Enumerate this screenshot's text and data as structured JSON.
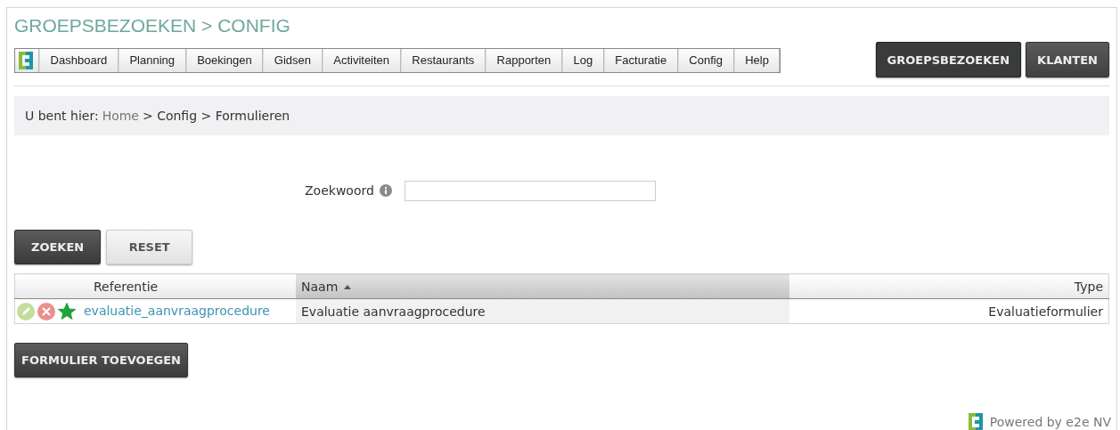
{
  "page_title": "GROEPSBEZOEKEN > CONFIG",
  "nav": [
    "Dashboard",
    "Planning",
    "Boekingen",
    "Gidsen",
    "Activiteiten",
    "Restaurants",
    "Rapporten",
    "Log",
    "Facturatie",
    "Config",
    "Help"
  ],
  "modules": [
    {
      "label": "GROEPSBEZOEKEN",
      "selected": true
    },
    {
      "label": "KLANTEN",
      "selected": false
    }
  ],
  "breadcrumb": {
    "prefix": "U bent hier:",
    "links": [
      "Home"
    ],
    "rest": "> Config > Formulieren"
  },
  "search": {
    "label": "Zoekwoord"
  },
  "search_buttons": [
    {
      "label": "ZOEKEN",
      "kind": "primary"
    },
    {
      "label": "RESET",
      "kind": "secondary"
    }
  ],
  "table": {
    "columns": [
      {
        "label": "Referentie",
        "sorted": false
      },
      {
        "label": "Naam",
        "sorted": true
      },
      {
        "label": "Type",
        "sorted": false
      }
    ],
    "rows": [
      {
        "favorite": true,
        "cells": [
          "evaluatie_aanvraagprocedure",
          "Evaluatie aanvraagprocedure",
          "Evaluatieformulier"
        ]
      }
    ]
  },
  "add_button": "FORMULIER TOEVOEGEN",
  "footer": "Powered by e2e NV"
}
